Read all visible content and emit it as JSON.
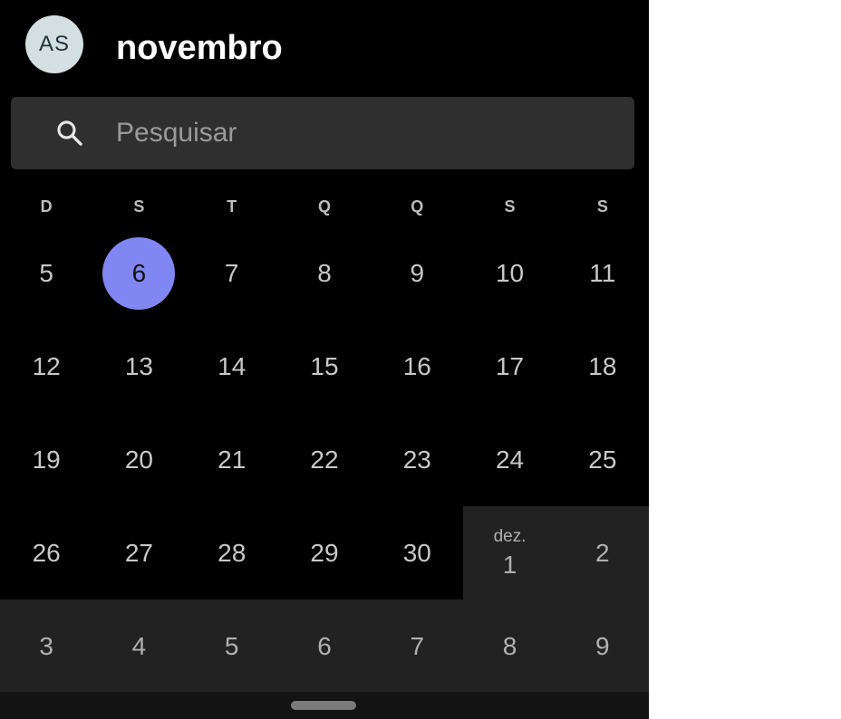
{
  "header": {
    "avatar_initials": "AS",
    "month_title": "novembro"
  },
  "search": {
    "placeholder": "Pesquisar",
    "icon": "search-icon"
  },
  "weekdays": [
    "D",
    "S",
    "T",
    "Q",
    "Q",
    "S",
    "S"
  ],
  "weeks": [
    [
      {
        "day": "5"
      },
      {
        "day": "6",
        "today": true
      },
      {
        "day": "7"
      },
      {
        "day": "8"
      },
      {
        "day": "9"
      },
      {
        "day": "10"
      },
      {
        "day": "11"
      }
    ],
    [
      {
        "day": "12"
      },
      {
        "day": "13"
      },
      {
        "day": "14"
      },
      {
        "day": "15"
      },
      {
        "day": "16"
      },
      {
        "day": "17"
      },
      {
        "day": "18"
      }
    ],
    [
      {
        "day": "19"
      },
      {
        "day": "20"
      },
      {
        "day": "21"
      },
      {
        "day": "22"
      },
      {
        "day": "23"
      },
      {
        "day": "24"
      },
      {
        "day": "25"
      }
    ],
    [
      {
        "day": "26"
      },
      {
        "day": "27"
      },
      {
        "day": "28"
      },
      {
        "day": "29"
      },
      {
        "day": "30"
      },
      {
        "day": "1",
        "next": true,
        "month_label": "dez."
      },
      {
        "day": "2",
        "next": true
      }
    ],
    [
      {
        "day": "3",
        "next": true
      },
      {
        "day": "4",
        "next": true
      },
      {
        "day": "5",
        "next": true
      },
      {
        "day": "6",
        "next": true
      },
      {
        "day": "7",
        "next": true
      },
      {
        "day": "8",
        "next": true
      },
      {
        "day": "9",
        "next": true
      }
    ]
  ],
  "colors": {
    "today_accent": "#8187f2",
    "next_month_bg": "#222222",
    "search_bg": "#2f2f2f",
    "avatar_bg": "#d4dfe2"
  }
}
